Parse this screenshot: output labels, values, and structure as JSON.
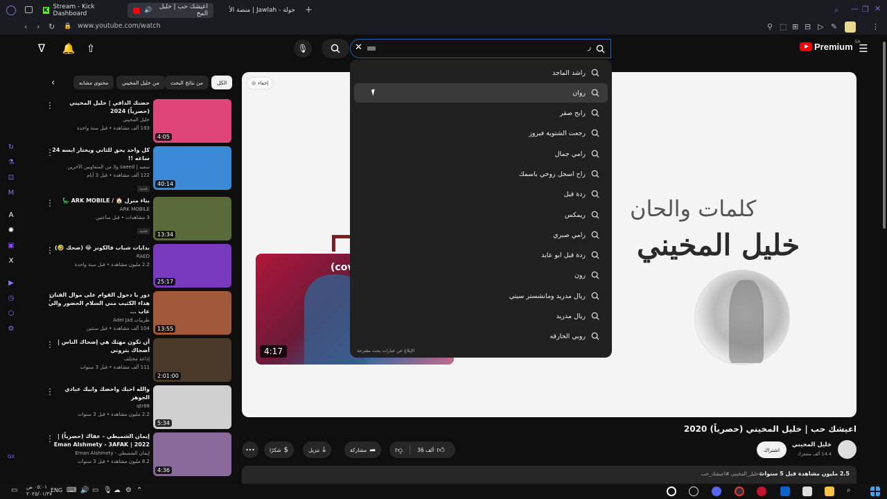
{
  "browser": {
    "tabs": [
      {
        "label": "Stream - Kick Dashboard",
        "active": false
      },
      {
        "label": "اعيشك حب | خليل المخ",
        "active": true
      },
      {
        "label": "جولة - Jawlah | منصة الأ",
        "active": false
      }
    ],
    "url": "www.youtube.com/watch"
  },
  "header": {
    "logo_text": "Premium",
    "logo_region": "SA",
    "search_value": "ر",
    "search_icon": "search-icon",
    "mic_icon": "mic-icon"
  },
  "suggestions": {
    "items": [
      "راشد الماجد",
      "روان",
      "رابح صقر",
      "رجعت الشتوية فيروز",
      "رامي جمال",
      "راح اسجل روحي باسمك",
      "ردة قبل",
      "ريمكس",
      "رامي صبري",
      "ردة قبل ابو عابد",
      "رون",
      "ريال مدريد ومانشستر سيتي",
      "ريال مدريد",
      "روبي الحارقه"
    ],
    "footer": "الإبلاغ عن عبارات بحث مقترحة"
  },
  "player": {
    "hide_label": "إخفاء",
    "art_line1": "كلمات والحان",
    "art_line2": "خليل المخيني",
    "mini_title": "(cove",
    "mini_duration": "4:17"
  },
  "chips": [
    "الكل",
    "من نتائج البحث",
    "من خليل المخيني",
    "محتوى مشابه"
  ],
  "related": [
    {
      "title": "حضنك الدافي | خليل المخيني (حصرياً) 2024",
      "channel": "خليل المخيني",
      "meta": "193 ألف مشاهدة • قبل سنة واحدة",
      "badge": "",
      "duration": "4:05",
      "thumb": "#e0457a"
    },
    {
      "title": "كل واحد يحق للثاني ويختار ابسه 24 ساعه !!",
      "channel": "سعيد | saeed و3 من المتعاونين الآخرين",
      "meta": "122 ألف مشاهدة • قبل 3 أيام",
      "badge": "جديد",
      "duration": "40:14",
      "thumb": "#3a8ad8"
    },
    {
      "title": "بناء منزل 🏠 / ARK MOBILE 🦕",
      "channel": "ARK MOBILE",
      "meta": "3 مشاهدات • قبل ساعتين",
      "badge": "جديد",
      "duration": "13:34",
      "thumb": "#5b6a3a"
    },
    {
      "title": "بدايات شباب فالكونز 😂 (ضحك 🤣)",
      "channel": "RAED",
      "meta": "2.2 مليون مشاهدة • قبل سنة واحدة",
      "badge": "",
      "duration": "25:17",
      "thumb": "#7a3ac0"
    },
    {
      "title": "دور يا دحول القوام على موال الفنان هذاء الكثيب مني السلام الحضور والي عاب ...",
      "channel": "طربيات Adel Jad",
      "meta": "104 ألف مشاهدة • قبل سنتين",
      "badge": "",
      "duration": "13:55",
      "thumb": "#a05a3a"
    },
    {
      "title": "أن تكون مهتك هي إضحاك الناس | أضحاك بتروني",
      "channel": "إذاعة مختلف",
      "meta": "111 ألف مشاهدة • قبل 3 سنوات",
      "badge": "",
      "duration": "2:01:00",
      "thumb": "#4a3a2a"
    },
    {
      "title": "والله احبك واحضك وابيك عبادي الجوهر",
      "channel": "qtr88",
      "meta": "2.2 مليون مشاهدة • قبل 3 سنوات",
      "badge": "",
      "duration": "5:34",
      "thumb": "#d0d0d0"
    },
    {
      "title": "إيمان الشميطي - عفاك (حصرياً) | 2022 | Eman Alshmety - 3AFAK",
      "channel": "إيمان الشميطي - Eman Alshmety",
      "meta": "8.2 مليون مشاهدة • قبل 3 سنوات",
      "badge": "",
      "duration": "4:36",
      "thumb": "#8a6a9a"
    }
  ],
  "video": {
    "title": "اعيشك حب | خليل المخيني (حصرياً) 2020",
    "channel": "خليل المخيني",
    "subscribers": "14.4 ألف مشترك",
    "subscribe": "اشتراك",
    "likes": "36 ألف",
    "share": "مشاركة",
    "download": "تنزيل",
    "thanks": "شكرًا",
    "views_line": "2.5 مليون مشاهدة قبل 5 سنوات",
    "tags": "#خليل_المخيني #اعيشك_حب"
  },
  "taskbar": {
    "lang": "ENG",
    "time": "٠٥:٠١ ص",
    "date": "٢٠٢٥/٠١/٢٧"
  }
}
